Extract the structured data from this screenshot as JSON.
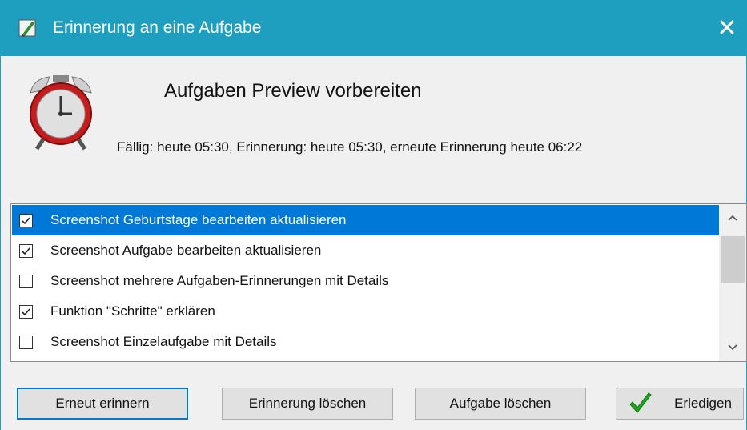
{
  "window": {
    "title": "Erinnerung an eine Aufgabe",
    "close_glyph": "✕"
  },
  "task": {
    "title": "Aufgaben Preview vorbereiten",
    "due_info": "Fällig: heute 05:30, Erinnerung: heute 05:30, erneute Erinnerung heute 06:22"
  },
  "items": [
    {
      "label": "Screenshot Geburtstage bearbeiten aktualisieren",
      "checked": true,
      "selected": true
    },
    {
      "label": "Screenshot Aufgabe bearbeiten aktualisieren",
      "checked": true,
      "selected": false
    },
    {
      "label": "Screenshot mehrere Aufgaben-Erinnerungen mit Details",
      "checked": false,
      "selected": false
    },
    {
      "label": "Funktion \"Schritte\" erklären",
      "checked": true,
      "selected": false
    },
    {
      "label": "Screenshot Einzelaufgabe mit Details",
      "checked": false,
      "selected": false
    }
  ],
  "buttons": {
    "remind_again": "Erneut erinnern",
    "delete_reminder": "Erinnerung löschen",
    "delete_task": "Aufgabe löschen",
    "done": "Erledigen"
  },
  "colors": {
    "titlebar": "#1e9fbf",
    "selection": "#0078d7",
    "checkmark_green": "#1fa51f"
  },
  "icons": [
    "app-icon",
    "alarm-clock-icon",
    "close-icon",
    "checkbox-icon",
    "scroll-up-icon",
    "scroll-down-icon",
    "green-check-icon"
  ]
}
